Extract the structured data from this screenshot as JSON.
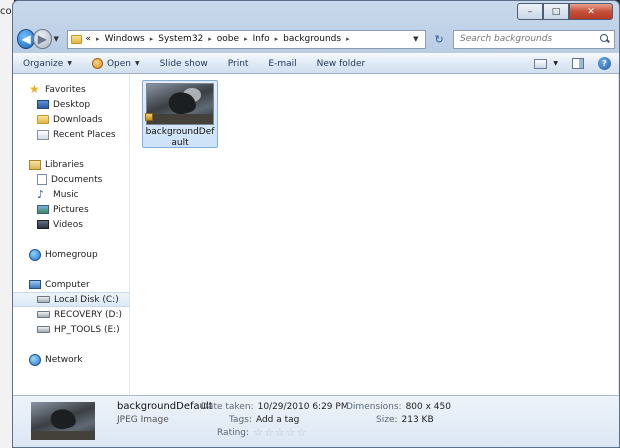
{
  "background_window": {
    "text": "co"
  },
  "window": {
    "caption": {
      "minimize": "–",
      "maximize": "□",
      "close": "✕"
    }
  },
  "address": {
    "overflow_marker": "«",
    "crumbs": [
      "Windows",
      "System32",
      "oobe",
      "Info",
      "backgrounds"
    ],
    "search_placeholder": "Search backgrounds"
  },
  "toolbar": {
    "organize": "Organize",
    "open": "Open",
    "slideshow": "Slide show",
    "print": "Print",
    "email": "E-mail",
    "new_folder": "New folder",
    "help": "?"
  },
  "nav": {
    "favorites": {
      "header": "Favorites",
      "items": [
        "Desktop",
        "Downloads",
        "Recent Places"
      ]
    },
    "libraries": {
      "header": "Libraries",
      "items": [
        "Documents",
        "Music",
        "Pictures",
        "Videos"
      ]
    },
    "homegroup": {
      "header": "Homegroup"
    },
    "computer": {
      "header": "Computer",
      "items": [
        "Local Disk (C:)",
        "RECOVERY (D:)",
        "HP_TOOLS (E:)"
      ],
      "selected_index": 0
    },
    "network": {
      "header": "Network"
    }
  },
  "files": [
    {
      "name": "backgroundDefault"
    }
  ],
  "details": {
    "name": "backgroundDefault",
    "type": "JPEG Image",
    "date_taken_label": "Date taken:",
    "date_taken": "10/29/2010 6:29 PM",
    "tags_label": "Tags:",
    "tags": "Add a tag",
    "rating_label": "Rating:",
    "rating": 0,
    "dimensions_label": "Dimensions:",
    "dimensions": "800 x 450",
    "size_label": "Size:",
    "size": "213 KB"
  },
  "colors": {
    "selection": "#cde2f8",
    "command_bar": "#dfe9f5",
    "link": "#1e395b"
  }
}
